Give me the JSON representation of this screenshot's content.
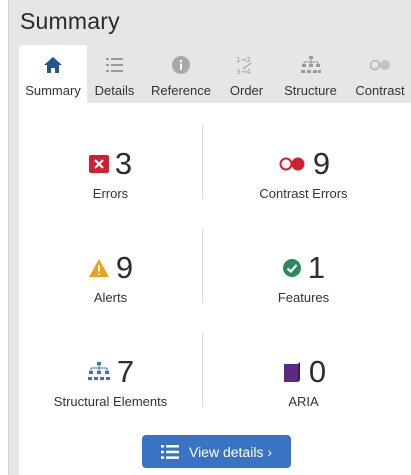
{
  "panel": {
    "title": "Summary"
  },
  "tabs": [
    {
      "label": "Summary",
      "icon": "home-icon",
      "active": true
    },
    {
      "label": "Details",
      "icon": "list-icon",
      "active": false
    },
    {
      "label": "Reference",
      "icon": "info-icon",
      "active": false
    },
    {
      "label": "Order",
      "icon": "order-icon",
      "active": false
    },
    {
      "label": "Structure",
      "icon": "structure-icon",
      "active": false
    },
    {
      "label": "Contrast",
      "icon": "contrast-icon",
      "active": false
    }
  ],
  "stats": {
    "errors": {
      "value": "3",
      "label": "Errors",
      "icon": "error-icon",
      "color": "#d0202f"
    },
    "contrast_errors": {
      "value": "9",
      "label": "Contrast Errors",
      "icon": "contrast-error-icon",
      "color": "#d0202f"
    },
    "alerts": {
      "value": "9",
      "label": "Alerts",
      "icon": "alert-icon",
      "color": "#e8a317"
    },
    "features": {
      "value": "1",
      "label": "Features",
      "icon": "feature-check-icon",
      "color": "#2e8b57"
    },
    "structural": {
      "value": "7",
      "label": "Structural Elements",
      "icon": "structure-elements-icon",
      "color": "#3a6fc4"
    },
    "aria": {
      "value": "0",
      "label": "ARIA",
      "icon": "aria-icon",
      "color": "#5b2a86"
    }
  },
  "button": {
    "label": "View details ›",
    "icon": "details-list-icon",
    "color": "#3b73c4"
  }
}
